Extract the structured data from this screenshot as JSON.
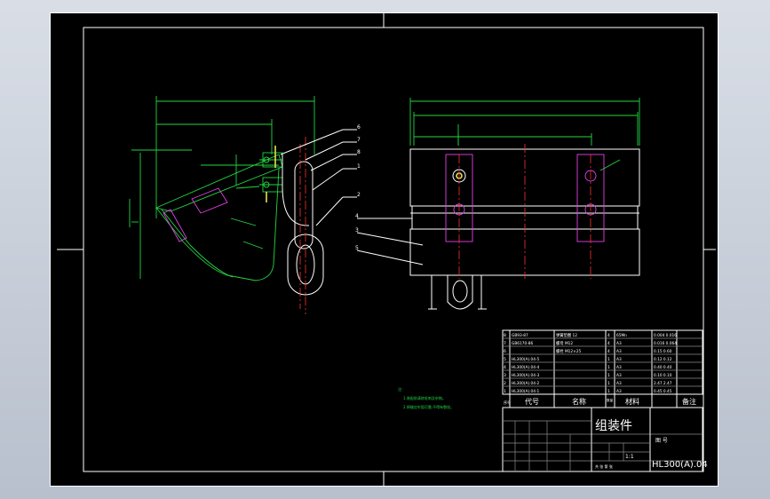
{
  "drawing": {
    "balloons": [
      "6",
      "7",
      "8",
      "1",
      "2",
      "4",
      "3",
      "5"
    ]
  },
  "bom": {
    "rows": [
      {
        "no": "8",
        "code": "GB93-87",
        "name": "弹簧垫圈 12",
        "qty": "4",
        "material": "65Mn",
        "note": "0.004 0.016"
      },
      {
        "no": "7",
        "code": "GB6170-86",
        "name": "螺母 M12",
        "qty": "4",
        "material": "A3",
        "note": "0.016 0.064"
      },
      {
        "no": "6",
        "code": "",
        "name": "螺栓 M12×25",
        "qty": "4",
        "material": "A3",
        "note": "0.15 0.60"
      },
      {
        "no": "5",
        "code": "HL300(A).04-5",
        "name": "",
        "qty": "1",
        "material": "A3",
        "note": "0.12 0.12"
      },
      {
        "no": "4",
        "code": "HL300(A).04-4",
        "name": "",
        "qty": "1",
        "material": "A3",
        "note": "0.40 0.40"
      },
      {
        "no": "3",
        "code": "HL300(A).04-3",
        "name": "",
        "qty": "1",
        "material": "A3",
        "note": "0.10 0.10"
      },
      {
        "no": "2",
        "code": "HL300(A).04-2",
        "name": "",
        "qty": "1",
        "material": "A3",
        "note": "2.47 2.47"
      },
      {
        "no": "1",
        "code": "HL300(A).04-1",
        "name": "",
        "qty": "1",
        "material": "A3",
        "note": "0.45 0.45"
      }
    ],
    "header": {
      "no": "序号",
      "code": "代号",
      "name": "名称",
      "qty": "数量",
      "material": "材料",
      "note": "备注"
    }
  },
  "notes": {
    "title": "注:",
    "lines": [
      "1.装配前清除毛刺及杂物。",
      "2.焊缝应牢固可靠,不得有裂纹。"
    ]
  },
  "title_block": {
    "part_name": "组装件",
    "label": "图 号",
    "drawing_no": "HL300(A).04",
    "scale": "1:1",
    "sheet_info": "共 张 第 张"
  }
}
